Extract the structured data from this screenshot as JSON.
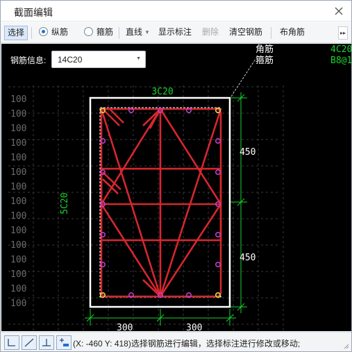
{
  "window": {
    "title": "截面编辑"
  },
  "toolbar": {
    "select_label": "选择",
    "longitudinal_label": "纵筋",
    "stirrup_label": "箍筋",
    "line_label": "直线",
    "show_annotation_label": "显示标注",
    "delete_label": "删除",
    "clear_rebar_label": "清空钢筋",
    "corner_rebar_label": "布角筋",
    "selected_mode": "纵筋"
  },
  "rebar_info": {
    "label": "钢筋信息:",
    "value": "14C20"
  },
  "drawing": {
    "grid_value": "100",
    "top_rebar_label": "3C20",
    "side_rebar_label": "5C20",
    "dim_upper": "450",
    "dim_lower": "450",
    "dim_left": "300",
    "dim_right": "300",
    "legend_corner": "角筋",
    "legend_stirrup": "箍筋",
    "corner_value": "4C20",
    "stirrup_value": "B8@1",
    "colors": {
      "background": "#000000",
      "section_outline": "#ffffff",
      "rebar": "#d7262e",
      "rebar_dot": "#c23ec8",
      "dimension": "#19d42e",
      "grid_text": "#6b6b6b"
    }
  },
  "status": {
    "coords": "(X: -460 Y: 418)",
    "message": "选择钢筋进行编辑，选择标注进行修改或移动;"
  }
}
